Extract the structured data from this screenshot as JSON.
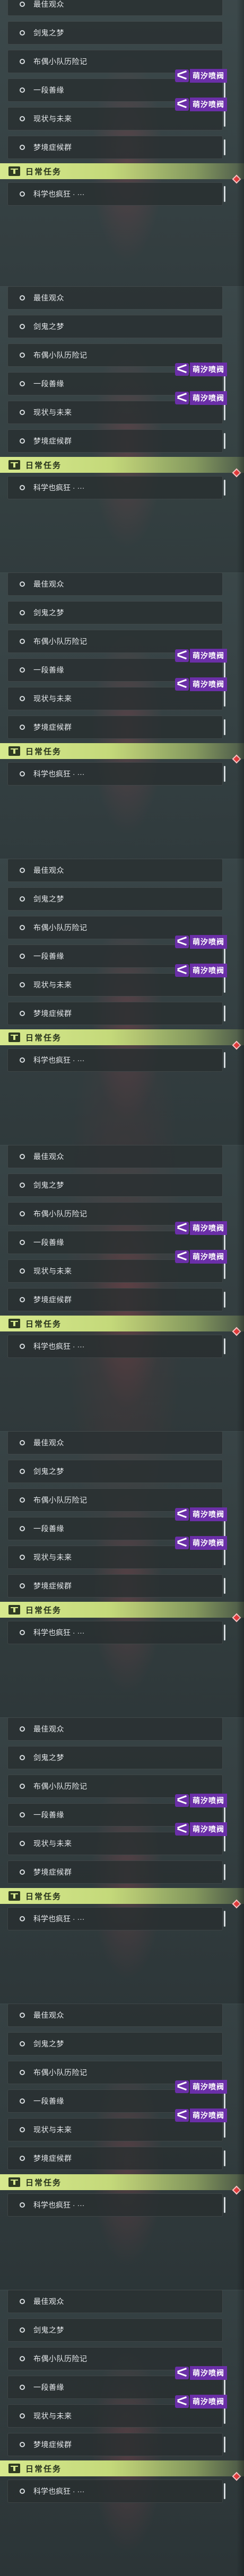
{
  "tasks": [
    "最佳观众",
    "剑鬼之梦",
    "布偶小队历险记",
    "一段善缘",
    "现状与未来",
    "梦境症候群"
  ],
  "section": {
    "title": "日常任务"
  },
  "subtask": {
    "label": "科学也疯狂 · ···"
  },
  "watermark": {
    "text": "萌汐喷阀"
  },
  "colors": {
    "section_accent": "#d7e98e",
    "watermark": "#6b2fa8",
    "marker": "#e23b3b"
  },
  "icons": [
    "circle-icon",
    "daily-task-icon",
    "diamond-marker-icon",
    "watermark-logo-icon"
  ]
}
